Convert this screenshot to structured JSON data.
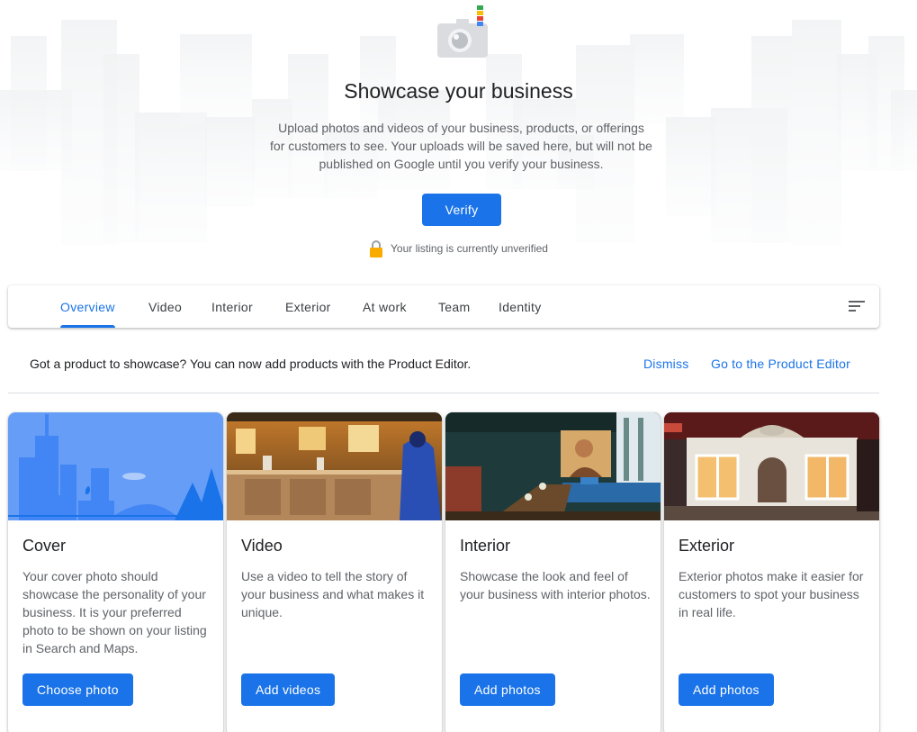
{
  "hero": {
    "title": "Showcase your business",
    "description": "Upload photos and videos of your business, products, or offerings for customers to see. Your uploads will be saved here, but will not be published on Google until you verify your business.",
    "verify_label": "Verify",
    "status_text": "Your listing is currently unverified",
    "icons": [
      "camera-icon",
      "lock-icon"
    ]
  },
  "tabs": [
    {
      "label": "Overview",
      "active": true
    },
    {
      "label": "Video",
      "active": false
    },
    {
      "label": "Interior",
      "active": false
    },
    {
      "label": "Exterior",
      "active": false
    },
    {
      "label": "At work",
      "active": false
    },
    {
      "label": "Team",
      "active": false
    },
    {
      "label": "Identity",
      "active": false
    }
  ],
  "banner": {
    "text": "Got a product to showcase? You can now add products with the Product Editor.",
    "dismiss_label": "Dismiss",
    "editor_label": "Go to the Product Editor"
  },
  "cards": [
    {
      "title": "Cover",
      "description": "Your cover photo should showcase the personality of your business. It is your preferred photo to be shown on your listing in Search and Maps.",
      "button": "Choose photo"
    },
    {
      "title": "Video",
      "description": "Use a video to tell the story of your business and what makes it unique.",
      "button": "Add videos"
    },
    {
      "title": "Interior",
      "description": "Showcase the look and feel of your business with interior photos.",
      "button": "Add photos"
    },
    {
      "title": "Exterior",
      "description": "Exterior photos make it easier for customers to spot your business in real life.",
      "button": "Add photos"
    }
  ],
  "colors": {
    "primary": "#1a73e8",
    "text": "#202124",
    "secondary_text": "#5f6368",
    "divider": "#dadce0",
    "lock": "#f9ab00"
  }
}
